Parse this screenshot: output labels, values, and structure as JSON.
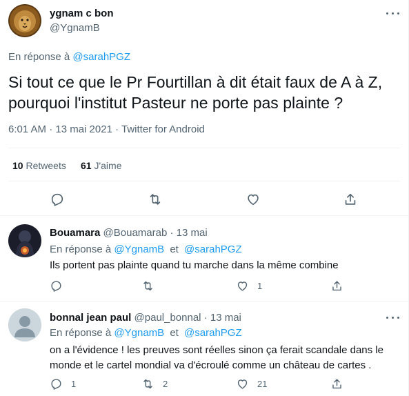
{
  "main_tweet": {
    "author_name": "ygnam c bon",
    "author_handle": "@YgnamB",
    "reply_prefix": "En réponse à",
    "reply_to": "@sarahPGZ",
    "text_line1": "Si tout ce que le Pr Fourtillan à dit était faux de A à Z,",
    "text_line2": "pourquoi l'institut Pasteur ne porte pas plainte ?",
    "timestamp": "6:01 AM · 13 mai 2021 · Twitter for Android",
    "retweets_count": "10",
    "retweets_label": "Retweets",
    "likes_count": "61",
    "likes_label": "J'aime"
  },
  "replies": [
    {
      "author_name": "Bouamara",
      "author_handle": "@Bouamarab",
      "date": "· 13 mai",
      "reply_prefix": "En réponse à",
      "reply_to_1": "@YgnamB",
      "conj": "et",
      "reply_to_2": "@sarahPGZ",
      "text_line1": "Ils portent pas plainte quand tu marche dans la même combine",
      "reply_count": "",
      "retweet_count": "",
      "like_count": "1"
    },
    {
      "author_name": "bonnal jean paul",
      "author_handle": "@paul_bonnal",
      "date": "· 13 mai",
      "reply_prefix": "En réponse à",
      "reply_to_1": "@YgnamB",
      "conj": "et",
      "reply_to_2": "@sarahPGZ",
      "text_line1": "on a l'évidence ! les preuves sont réelles sinon ça ferait scandale dans le",
      "text_line2": "monde et le cartel mondial va d'écroulé comme un château de cartes  .",
      "reply_count": "1",
      "retweet_count": "2",
      "like_count": "21"
    }
  ],
  "colors": {
    "accent": "#1d9bf0",
    "secondary_text": "#536471",
    "divider": "#eff3f4"
  }
}
